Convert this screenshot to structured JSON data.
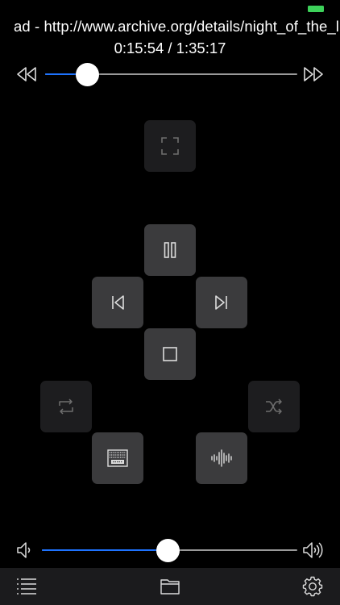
{
  "status": {
    "battery_color": "#3dd15a"
  },
  "now_playing": {
    "title_visible": "ad - http://www.archive.org/details/night_of_the_li"
  },
  "time": {
    "display": "0:15:54 / 1:35:17",
    "elapsed": "0:15:54",
    "total": "1:35:17"
  },
  "seek": {
    "progress_percent": 16.8,
    "fill_color": "#1e73ff",
    "back_icon": "rewind-icon",
    "forward_icon": "fast-forward-icon"
  },
  "controls": {
    "fullscreen": {
      "icon": "fullscreen-icon",
      "enabled": false
    },
    "play_pause": {
      "icon": "pause-icon",
      "enabled": true
    },
    "previous": {
      "icon": "skip-previous-icon",
      "enabled": true
    },
    "next": {
      "icon": "skip-next-icon",
      "enabled": true
    },
    "stop": {
      "icon": "stop-icon",
      "enabled": true
    },
    "repeat": {
      "icon": "repeat-icon",
      "enabled": false
    },
    "shuffle": {
      "icon": "shuffle-icon",
      "enabled": false
    },
    "subtitles": {
      "icon": "subtitles-icon",
      "enabled": true
    },
    "audio_track": {
      "icon": "audio-waveform-icon",
      "enabled": true
    }
  },
  "volume": {
    "level_percent": 49.3,
    "fill_color": "#1e73ff",
    "low_icon": "volume-low-icon",
    "high_icon": "volume-high-icon"
  },
  "toolbar": {
    "playlist_icon": "playlist-icon",
    "browse_icon": "folder-icon",
    "settings_icon": "gear-icon"
  }
}
